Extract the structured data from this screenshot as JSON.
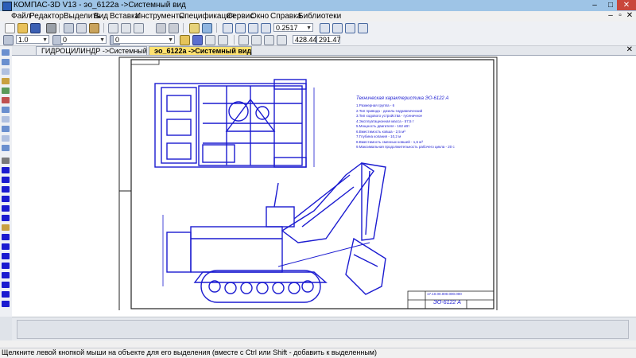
{
  "window": {
    "title": "КОМПАС-3D V13 - эо_6122а ->Системный вид",
    "min_label": "–",
    "max_label": "□",
    "close_label": "✕"
  },
  "menu": {
    "items": [
      "Файл",
      "Редактор",
      "Выделить",
      "Вид",
      "Вставка",
      "Инструменты",
      "Спецификация",
      "Сервис",
      "Окно",
      "Справка",
      "Библиотеки"
    ]
  },
  "toolbar": {
    "zoom_value": "0.2517",
    "coord_x": "428.44",
    "coord_y": "291.47",
    "line_scale": "1.0",
    "layer_value": "0",
    "style_value": "0"
  },
  "tabs": [
    {
      "label": "ГИДРОЦИЛИНДР ->Системный вид"
    },
    {
      "label": "эо_6122а ->Системный вид"
    }
  ],
  "drawing": {
    "spec_title": "Техническая характеристика ЭО-6122 А",
    "spec_lines": [
      "1.Размерная группа - 6",
      "2.Тип привода - дизель-гидравлический",
      "3.Тип ходового устройства - гусеничное",
      "4.Эксплуатационная масса - 57,5 т",
      "5.Мощность двигателя - 162 кВт",
      "6.Вместимость ковша - 2,5 м³",
      "7.Глубина копания - 10,2 м",
      "8.Вместимость сменных ковшей - 1,6 м³",
      "9.Максимальная продолжительность рабочего цикла - 20 с"
    ],
    "stamp_code": "ЭО-6122 А",
    "stamp_top": "17.10.00.000.000.000"
  },
  "status": {
    "text": "Щелкните левой кнопкой мыши на объекте для его выделения (вместе с Ctrl или Shift - добавить к выделенным)"
  },
  "colors": {
    "drawing_lines": "#1b1bd0",
    "title_bar": "#9ec4e6",
    "active_tab": "#ffe270"
  },
  "icons": {
    "toolbar": [
      "new-file-icon",
      "open-icon",
      "save-icon",
      "print-icon",
      "cut-icon",
      "copy-icon",
      "paste-icon",
      "undo-icon",
      "redo-icon",
      "zoom-in-icon",
      "zoom-out-icon",
      "pan-icon",
      "refresh-icon"
    ],
    "left": [
      "select-icon",
      "line-icon",
      "circle-icon",
      "arc-icon",
      "dimension-icon",
      "hatch-icon",
      "text-icon",
      "table-icon"
    ]
  }
}
